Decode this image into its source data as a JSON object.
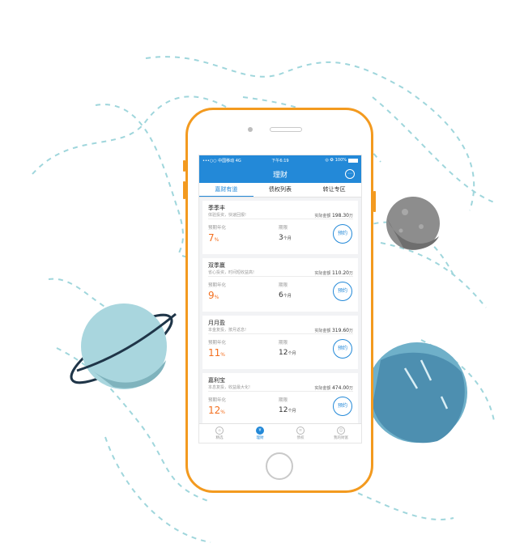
{
  "status_bar": {
    "carrier": "•••○○ 中国移动  4G",
    "time": "下午6:19",
    "icons": "◎ ✪",
    "battery_label": "100%",
    "battery_level": 1.0
  },
  "header": {
    "title": "理财",
    "more_icon": "⋯"
  },
  "tabs": [
    {
      "label": "嘉财有道",
      "active": true
    },
    {
      "label": "债权列表",
      "active": false
    },
    {
      "label": "转让专区",
      "active": false
    }
  ],
  "products": [
    {
      "name": "季季丰",
      "desc": "体验投资，快速回报!",
      "amount_label": "实际金额",
      "amount_value": "198.30",
      "amount_unit": "万",
      "rate_label": "预期年化",
      "rate_value": "7",
      "rate_unit": "%",
      "term_label": "期限",
      "term_value": "3",
      "term_unit": "个月",
      "button": "预约"
    },
    {
      "name": "双季赢",
      "desc": "省心投资，时间短收益高!",
      "amount_label": "实际金额",
      "amount_value": "110.20",
      "amount_unit": "万",
      "rate_label": "预期年化",
      "rate_value": "9",
      "rate_unit": "%",
      "term_label": "期限",
      "term_value": "6",
      "term_unit": "个月",
      "button": "预约"
    },
    {
      "name": "月月盈",
      "desc": "本金复投，按月返息!",
      "amount_label": "实际金额",
      "amount_value": "319.60",
      "amount_unit": "万",
      "rate_label": "预期年化",
      "rate_value": "11",
      "rate_unit": "%",
      "term_label": "期限",
      "term_value": "12",
      "term_unit": "个月",
      "button": "预约"
    },
    {
      "name": "嘉利宝",
      "desc": "本息复投，收益最大化!",
      "amount_label": "实际金额",
      "amount_value": "474.00",
      "amount_unit": "万",
      "rate_label": "预期年化",
      "rate_value": "12",
      "rate_unit": "%",
      "term_label": "期限",
      "term_value": "12",
      "term_unit": "个月",
      "button": "预约"
    }
  ],
  "bottom_nav": [
    {
      "label": "精选",
      "icon": "home-icon",
      "glyph": "⌂",
      "active": false
    },
    {
      "label": "理财",
      "icon": "money-icon",
      "glyph": "¥",
      "active": true
    },
    {
      "label": "债权",
      "icon": "bond-icon",
      "glyph": "≡",
      "active": false
    },
    {
      "label": "我的财富",
      "icon": "user-icon",
      "glyph": "☺",
      "active": false
    }
  ],
  "colors": {
    "brand_blue": "#2389d8",
    "phone_frame": "#f39a1f",
    "rate_orange": "#f36f1f",
    "dashed_line": "#8fcfd6",
    "planet_light": "#a9d6de",
    "planet_blue": "#4d8fb0",
    "moon_gray": "#8d8d8d",
    "ring_navy": "#1f3548"
  }
}
